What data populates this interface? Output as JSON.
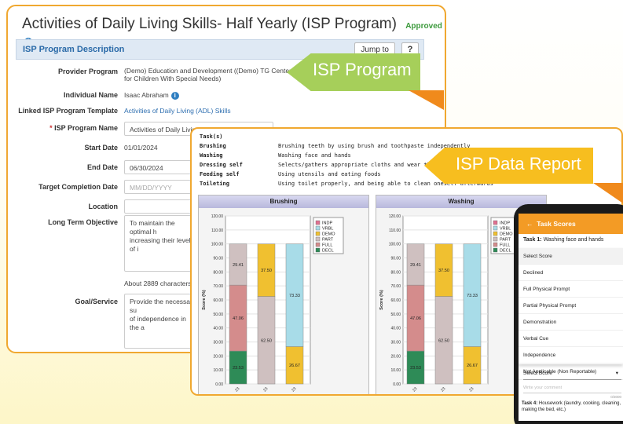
{
  "isp": {
    "title": "Activities of Daily Living Skills- Half Yearly (ISP Program)",
    "status": "Approved",
    "section_title": "ISP Program Description",
    "jump_label": "Jump to",
    "help_label": "?",
    "fields": {
      "provider_program_label": "Provider Program",
      "provider_program_value_1": "(Demo) Education and Development ((Demo) TG Center",
      "provider_program_value_2": "for Children With Special Needs)",
      "individual_name_label": "Individual Name",
      "individual_name_value": "Isaac Abraham",
      "template_label": "Linked ISP Program Template",
      "template_value": "Activities of Daily Living (ADL) Skills",
      "program_name_label": "ISP Program Name",
      "program_name_value": "Activities of Daily Living Skills- Half Yearly",
      "start_date_label": "Start Date",
      "start_date_value": "01/01/2024",
      "end_date_label": "End Date",
      "end_date_value": "06/30/2024",
      "target_date_label": "Target Completion Date",
      "target_date_placeholder": "MM/DD/YYYY",
      "location_label": "Location",
      "lto_label": "Long Term Objective",
      "lto_value_1": "To maintain the optimal h",
      "lto_value_2": "increasing their level of i",
      "chars_left": "About 2889 characters left",
      "goal_label": "Goal/Service",
      "goal_value_1": "Provide the necessary su",
      "goal_value_2": "of independence in the a"
    }
  },
  "banners": {
    "isp_program": "ISP Program",
    "isp_data_report": "ISP Data Report"
  },
  "report": {
    "task_header": "Task(s)",
    "tasks": [
      {
        "name": "Brushing",
        "desc": "Brushing teeth by using brush and toothpaste independently"
      },
      {
        "name": "Washing",
        "desc": "Washing face and hands"
      },
      {
        "name": "Dressing self",
        "desc": "Selects/gathers appropriate cloths and wear those"
      },
      {
        "name": "Feeding self",
        "desc": "Using utensils and eating foods"
      },
      {
        "name": "Toileting",
        "desc": "Using toilet properly, and being able to clean oneself afterwards"
      }
    ]
  },
  "chart_data": [
    {
      "type": "bar",
      "title": "Brushing",
      "ylabel": "Score (%)",
      "ylim": [
        0,
        120
      ],
      "yticks": [
        "0.00",
        "10.00",
        "20.00",
        "30.00",
        "40.00",
        "50.00",
        "60.00",
        "70.00",
        "80.00",
        "90.00",
        "100.00",
        "110.00",
        "120.00"
      ],
      "categories": [
        "23",
        "23",
        "23"
      ],
      "legend": [
        "INDP",
        "VRBL",
        "DEMO",
        "PART",
        "FULL",
        "DECL"
      ],
      "stacks": [
        [
          {
            "key": "DECL",
            "value": 23.53,
            "color": "#2e8b57"
          },
          {
            "key": "FULL",
            "value": 47.06,
            "color": "#d48c8c"
          },
          {
            "key": "PART",
            "value": 29.41,
            "color": "#cfc0c0"
          }
        ],
        [
          {
            "key": "FULL",
            "value": 62.5,
            "color": "#cfc0c0"
          },
          {
            "key": "DEMO",
            "value": 37.5,
            "color": "#f0c030"
          }
        ],
        [
          {
            "key": "DEMO",
            "value": 26.67,
            "color": "#f0c030"
          },
          {
            "key": "VRBL",
            "value": 73.33,
            "color": "#a8dce8"
          }
        ]
      ]
    },
    {
      "type": "bar",
      "title": "Washing",
      "ylabel": "Score (%)",
      "ylim": [
        0,
        120
      ],
      "yticks": [
        "0.00",
        "10.00",
        "20.00",
        "30.00",
        "40.00",
        "50.00",
        "60.00",
        "70.00",
        "80.00",
        "90.00",
        "100.00",
        "110.00",
        "120.00"
      ],
      "categories": [
        "23",
        "23",
        "23"
      ],
      "legend": [
        "INDP",
        "VRBL",
        "DEMO",
        "PART",
        "FULL",
        "DECL"
      ],
      "stacks": [
        [
          {
            "key": "DECL",
            "value": 23.53,
            "color": "#2e8b57"
          },
          {
            "key": "FULL",
            "value": 47.06,
            "color": "#d48c8c"
          },
          {
            "key": "PART",
            "value": 29.41,
            "color": "#cfc0c0"
          }
        ],
        [
          {
            "key": "FULL",
            "value": 62.5,
            "color": "#cfc0c0"
          },
          {
            "key": "DEMO",
            "value": 37.5,
            "color": "#f0c030"
          }
        ],
        [
          {
            "key": "DEMO",
            "value": 26.67,
            "color": "#f0c030"
          },
          {
            "key": "VRBL",
            "value": 73.33,
            "color": "#a8dce8"
          }
        ]
      ]
    }
  ],
  "legend_colors": {
    "INDP": "#e07090",
    "VRBL": "#a8dce8",
    "DEMO": "#f0c030",
    "PART": "#cfc0c0",
    "FULL": "#d48c8c",
    "DECL": "#2e8b57"
  },
  "phone": {
    "header": "Task Scores",
    "task1_prefix": "Task 1:",
    "task1_name": "Washing face and hands",
    "options": [
      "Select Score",
      "Declined",
      "Full Physical Prompt",
      "Partial Physical Prompt",
      "Demonstration",
      "Verbal Cue",
      "Independence",
      "Not Applicable (Non Reportable)"
    ],
    "select_label": "Select Score",
    "comment_placeholder": "Write your comment",
    "comment_count": "0/3000",
    "task4_prefix": "Task 4:",
    "task4_name": "Housework (laundry, cooking, cleaning, making the bed, etc.)"
  }
}
